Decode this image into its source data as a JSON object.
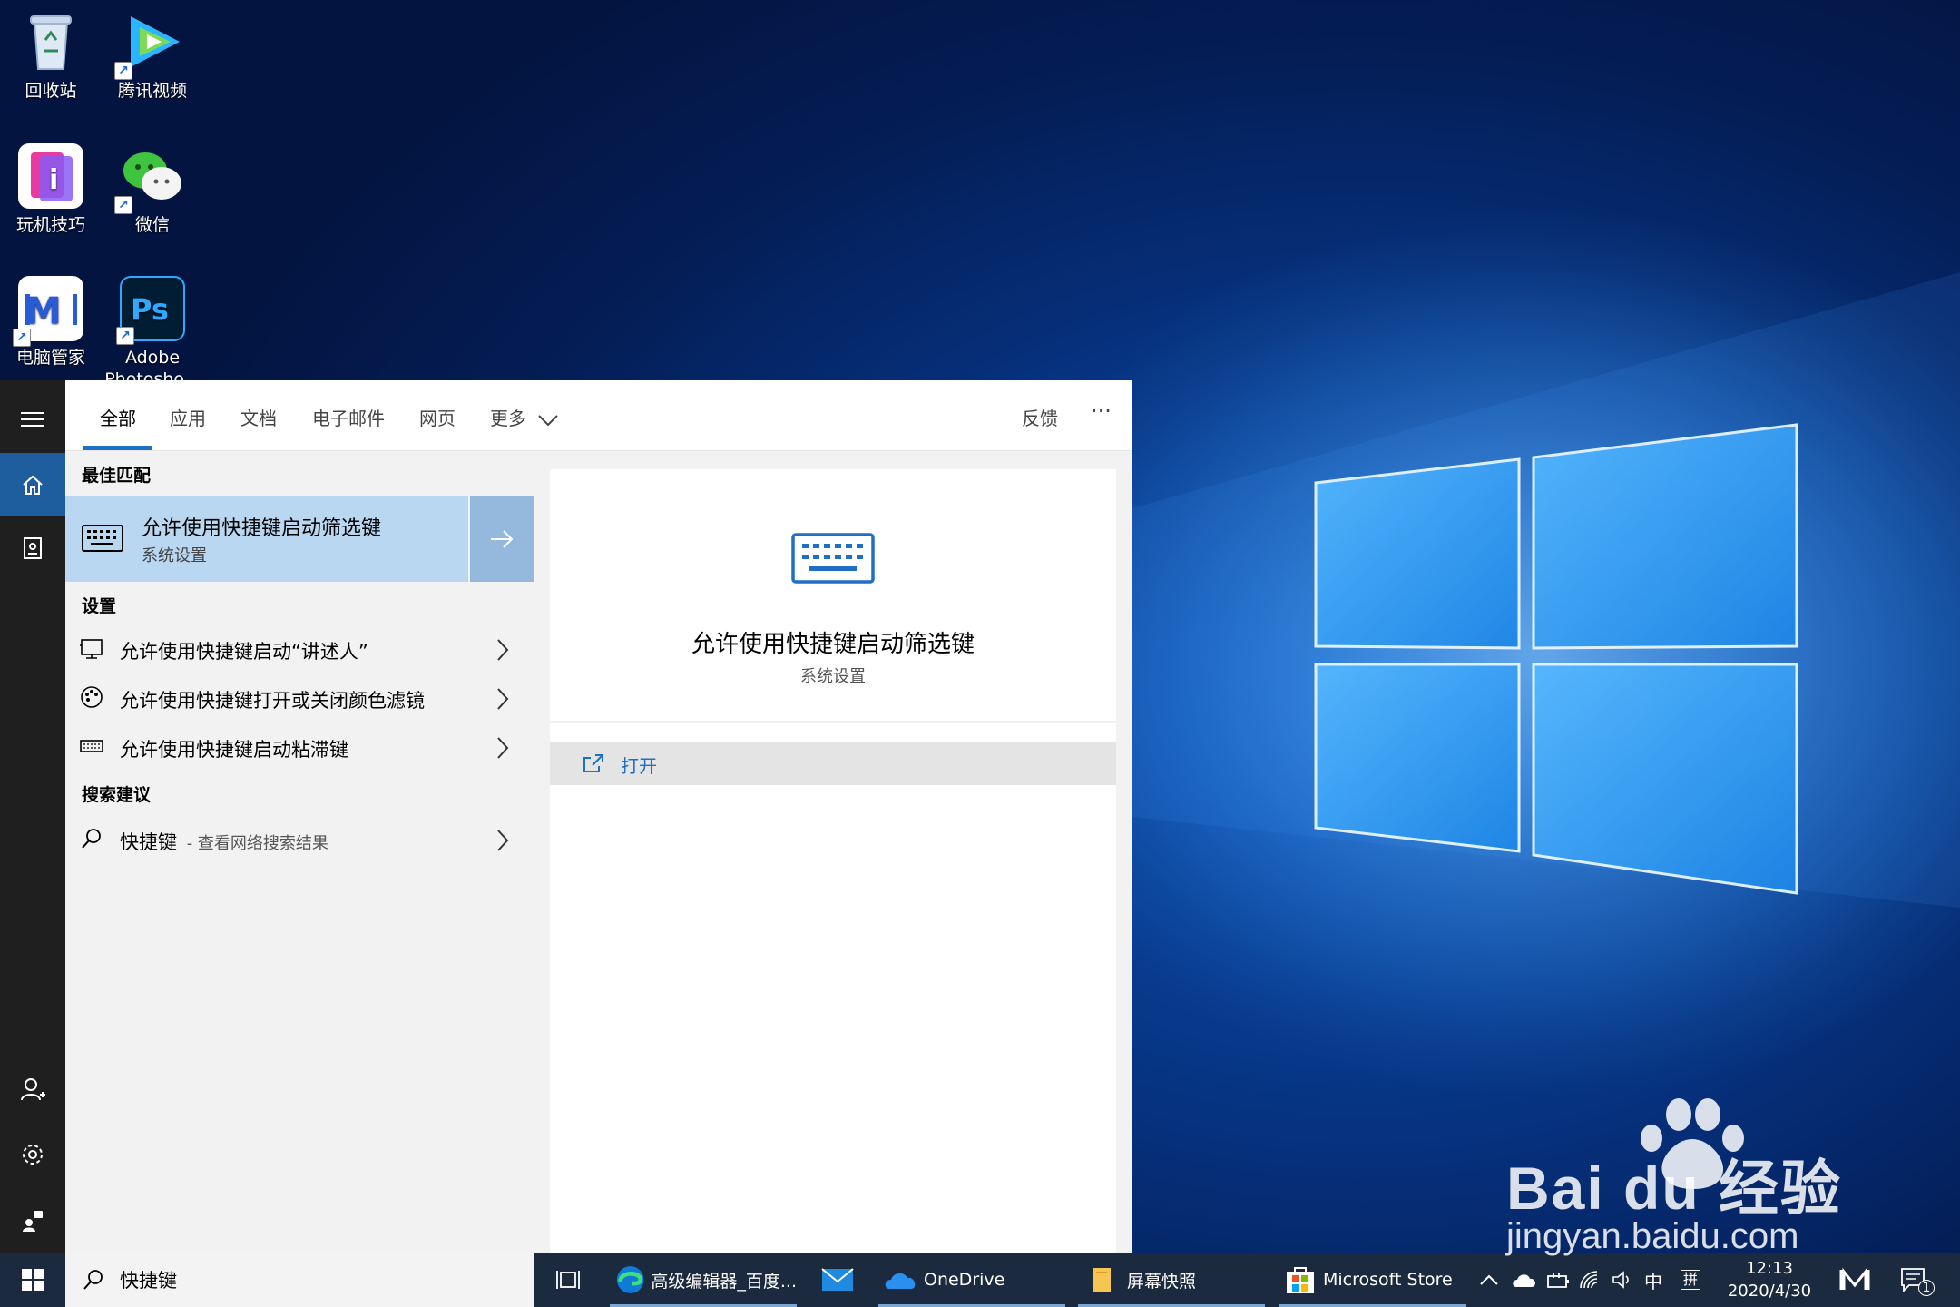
{
  "desktop": {
    "icons": [
      {
        "label": "回收站",
        "icon": "recycle-bin-icon"
      },
      {
        "label": "腾讯视频",
        "icon": "tencent-video-icon"
      },
      {
        "label": "玩机技巧",
        "icon": "tips-icon"
      },
      {
        "label": "微信",
        "icon": "wechat-icon"
      },
      {
        "label": "电脑管家",
        "icon": "pc-manager-icon"
      },
      {
        "label": "Adobe Photosho...",
        "icon": "photoshop-icon",
        "label_line1": "Adobe",
        "label_line2": "Photosho..."
      }
    ]
  },
  "search": {
    "tabs": [
      {
        "label": "全部",
        "active": true
      },
      {
        "label": "应用"
      },
      {
        "label": "文档"
      },
      {
        "label": "电子邮件"
      },
      {
        "label": "网页"
      },
      {
        "label": "更多"
      }
    ],
    "feedback_label": "反馈",
    "more_options_label": "···",
    "best_match": {
      "section_title": "最佳匹配",
      "title": "允许使用快捷键启动筛选键",
      "subtitle": "系统设置"
    },
    "settings": {
      "section_title": "设置",
      "items": [
        {
          "label": "允许使用快捷键启动“讲述人”",
          "icon": "narrator-icon"
        },
        {
          "label": "允许使用快捷键打开或关闭颜色滤镜",
          "icon": "color-palette-icon"
        },
        {
          "label": "允许使用快捷键启动粘滞键",
          "icon": "keyboard-icon"
        }
      ]
    },
    "suggestions": {
      "section_title": "搜索建议",
      "query": "快捷键",
      "hint": "- 查看网络搜索结果"
    },
    "preview": {
      "title": "允许使用快捷键启动筛选键",
      "subtitle": "系统设置",
      "open_label": "打开"
    },
    "input_value": "快捷键"
  },
  "taskbar": {
    "apps": [
      {
        "label": "高级编辑器_百度...",
        "icon": "edge-icon"
      },
      {
        "label": "",
        "icon": "mail-icon"
      },
      {
        "label": "OneDrive",
        "icon": "onedrive-icon"
      },
      {
        "label": "屏幕快照",
        "icon": "folder-icon"
      },
      {
        "label": "Microsoft Store",
        "icon": "store-icon"
      }
    ],
    "ime_label": "中",
    "ime_mode": "拼",
    "time": "12:13",
    "date": "2020/4/30",
    "notification_count": "1"
  },
  "watermark": {
    "brand": "Bai du 经验",
    "url": "jingyan.baidu.com"
  },
  "colors": {
    "accent": "#1f6fc4",
    "best_match_bg": "#b9d7f1",
    "taskbar": "#1c2a3f",
    "rail": "#1f1f1f"
  }
}
